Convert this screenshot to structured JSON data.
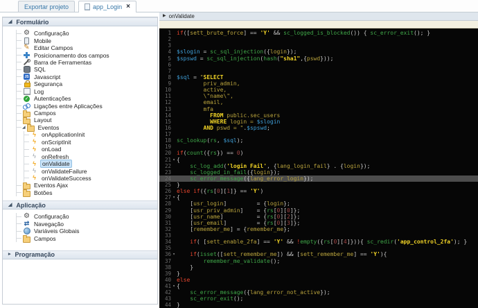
{
  "tabs": [
    {
      "label": "Exportar projeto",
      "active": false
    },
    {
      "label": "app_Login",
      "active": true,
      "icon": "document",
      "close": "×"
    }
  ],
  "sidebar": {
    "sections": [
      {
        "title": "Formulário",
        "state": "expanded",
        "items": [
          {
            "label": "Configuração",
            "icon": "gear"
          },
          {
            "label": "Mobile",
            "icon": "phone"
          },
          {
            "label": "Editar Campos",
            "icon": "edit"
          },
          {
            "label": "Posicionamento dos campos",
            "icon": "move"
          },
          {
            "label": "Barra de Ferramentas",
            "icon": "tools"
          },
          {
            "label": "SQL",
            "icon": "db"
          },
          {
            "label": "Javascript",
            "icon": "js"
          },
          {
            "label": "Segurança",
            "icon": "lock"
          },
          {
            "label": "Log",
            "icon": "log"
          },
          {
            "label": "Autenticações",
            "icon": "auth"
          },
          {
            "label": "Ligações entre Aplicações",
            "icon": "link"
          },
          {
            "label": "Campos",
            "icon": "folder"
          },
          {
            "label": "Layout",
            "icon": "folder"
          },
          {
            "label": "Eventos",
            "icon": "folder",
            "expanded": true,
            "children": [
              {
                "label": "onApplicationInit",
                "icon": "bolt"
              },
              {
                "label": "onScriptInit",
                "icon": "bolt"
              },
              {
                "label": "onLoad",
                "icon": "bolt"
              },
              {
                "label": "onRefresh",
                "icon": "boltg"
              },
              {
                "label": "onValidate",
                "icon": "bolt",
                "selected": true
              },
              {
                "label": "onValidateFailure",
                "icon": "boltg"
              },
              {
                "label": "onValidateSuccess",
                "icon": "bolt"
              }
            ]
          },
          {
            "label": "Eventos Ajax",
            "icon": "folder"
          },
          {
            "label": "Botões",
            "icon": "folder"
          }
        ]
      },
      {
        "title": "Aplicação",
        "state": "expanded",
        "items": [
          {
            "label": "Configuração",
            "icon": "gear"
          },
          {
            "label": "Navegação",
            "icon": "nav"
          },
          {
            "label": "Variáveis Globais",
            "icon": "globe"
          },
          {
            "label": "Campos",
            "icon": "folder"
          }
        ]
      },
      {
        "title": "Programação",
        "state": "collapsed",
        "items": []
      }
    ]
  },
  "editor": {
    "header": {
      "title": "onValidate"
    },
    "palette": {
      "background": "#060606",
      "keyword": "#e8462e",
      "function": "#3fa648",
      "variable": "#3f9fd8",
      "field": "#b9a33c",
      "string": "#f2d426",
      "number": "#a04545",
      "plain": "#c9c9c9",
      "active_line": "#4c4c4c",
      "selected_item": "#c9e3f8"
    },
    "lines": [
      {
        "n": 1,
        "tk": [
          [
            "k",
            "if"
          ],
          [
            "p",
            "(["
          ],
          [
            "g",
            "sett_brute_force"
          ],
          [
            "p",
            "] == "
          ],
          [
            "s",
            "'Y'"
          ],
          [
            "p",
            " && "
          ],
          [
            "f",
            "sc_logged_is_blocked"
          ],
          [
            "p",
            "()) { "
          ],
          [
            "f",
            "sc_error_exit"
          ],
          [
            "p",
            "(); }"
          ]
        ]
      },
      {
        "n": 2,
        "tk": []
      },
      {
        "n": 3,
        "tk": []
      },
      {
        "n": 4,
        "tk": [
          [
            "v",
            "$slogin"
          ],
          [
            "p",
            " = "
          ],
          [
            "f",
            "sc_sql_injection"
          ],
          [
            "p",
            "({"
          ],
          [
            "g",
            "login"
          ],
          [
            "p",
            "});"
          ]
        ]
      },
      {
        "n": 5,
        "tk": [
          [
            "v",
            "$spswd"
          ],
          [
            "p",
            " = "
          ],
          [
            "f",
            "sc_sql_injection"
          ],
          [
            "p",
            "("
          ],
          [
            "f",
            "hash"
          ],
          [
            "p",
            "("
          ],
          [
            "s",
            "\"sha1\""
          ],
          [
            "p",
            ",{"
          ],
          [
            "g",
            "pswd"
          ],
          [
            "p",
            "}));"
          ]
        ]
      },
      {
        "n": 6,
        "tk": []
      },
      {
        "n": 7,
        "tk": []
      },
      {
        "n": 8,
        "tk": [
          [
            "v",
            "$sql"
          ],
          [
            "p",
            " = "
          ],
          [
            "t",
            "\""
          ],
          [
            "q",
            "SELECT"
          ]
        ]
      },
      {
        "n": 9,
        "tk": [
          [
            "t",
            "        priv_admin,"
          ]
        ]
      },
      {
        "n": 10,
        "tk": [
          [
            "t",
            "        active,"
          ]
        ]
      },
      {
        "n": 11,
        "tk": [
          [
            "t",
            "        \\\"name\\\","
          ]
        ]
      },
      {
        "n": 12,
        "tk": [
          [
            "t",
            "        email,"
          ]
        ]
      },
      {
        "n": 13,
        "tk": [
          [
            "t",
            "        mfa"
          ]
        ]
      },
      {
        "n": 14,
        "tk": [
          [
            "t",
            "          "
          ],
          [
            "q",
            "FROM"
          ],
          [
            "t",
            " public.sec_users"
          ]
        ]
      },
      {
        "n": 15,
        "tk": [
          [
            "t",
            "          "
          ],
          [
            "q",
            "WHERE"
          ],
          [
            "t",
            " login = "
          ],
          [
            "v",
            "$slogin"
          ]
        ]
      },
      {
        "n": 16,
        "tk": [
          [
            "t",
            "        "
          ],
          [
            "q",
            "AND"
          ],
          [
            "t",
            " pswd = \""
          ],
          [
            "p",
            "."
          ],
          [
            "v",
            "$spswd"
          ],
          [
            "p",
            ";"
          ]
        ]
      },
      {
        "n": 17,
        "tk": []
      },
      {
        "n": 18,
        "tk": [
          [
            "f",
            "sc_lookup"
          ],
          [
            "p",
            "("
          ],
          [
            "f",
            "rs"
          ],
          [
            "p",
            ", "
          ],
          [
            "v",
            "$sql"
          ],
          [
            "p",
            ");"
          ]
        ]
      },
      {
        "n": 19,
        "tk": []
      },
      {
        "n": 20,
        "tk": [
          [
            "k",
            "if"
          ],
          [
            "p",
            "("
          ],
          [
            "f",
            "count"
          ],
          [
            "p",
            "({"
          ],
          [
            "f",
            "rs"
          ],
          [
            "p",
            "}) == "
          ],
          [
            "n",
            "0"
          ],
          [
            "p",
            ")"
          ]
        ]
      },
      {
        "n": 21,
        "fold": true,
        "tk": [
          [
            "p",
            "{"
          ]
        ]
      },
      {
        "n": 22,
        "tk": [
          [
            "p",
            "    "
          ],
          [
            "f",
            "sc_log_add"
          ],
          [
            "p",
            "("
          ],
          [
            "s",
            "'login Fail'"
          ],
          [
            "p",
            ", {"
          ],
          [
            "g",
            "lang_login_fail"
          ],
          [
            "p",
            "} . {"
          ],
          [
            "g",
            "login"
          ],
          [
            "p",
            "});"
          ]
        ]
      },
      {
        "n": 23,
        "tk": [
          [
            "p",
            "    "
          ],
          [
            "f",
            "sc_logged_in_fail"
          ],
          [
            "p",
            "({"
          ],
          [
            "g",
            "login"
          ],
          [
            "p",
            "});"
          ]
        ]
      },
      {
        "n": 24,
        "active": true,
        "tk": [
          [
            "p",
            "    "
          ],
          [
            "f",
            "sc_error_message"
          ],
          [
            "p",
            "({"
          ],
          [
            "g",
            "lang_error_login"
          ],
          [
            "p",
            "});"
          ]
        ]
      },
      {
        "n": 25,
        "tk": [
          [
            "p",
            "}"
          ]
        ]
      },
      {
        "n": 26,
        "tk": [
          [
            "k",
            "else"
          ],
          [
            "p",
            " "
          ],
          [
            "k",
            "if"
          ],
          [
            "p",
            "({"
          ],
          [
            "f",
            "rs"
          ],
          [
            "p",
            "["
          ],
          [
            "n",
            "0"
          ],
          [
            "p",
            "]["
          ],
          [
            "n",
            "1"
          ],
          [
            "p",
            "]} == "
          ],
          [
            "s",
            "'Y'"
          ],
          [
            "p",
            ")"
          ]
        ]
      },
      {
        "n": 27,
        "fold": true,
        "tk": [
          [
            "p",
            "{"
          ]
        ]
      },
      {
        "n": 28,
        "tk": [
          [
            "p",
            "    ["
          ],
          [
            "g",
            "usr_login"
          ],
          [
            "p",
            "]         = {"
          ],
          [
            "g",
            "login"
          ],
          [
            "p",
            "};"
          ]
        ]
      },
      {
        "n": 29,
        "tk": [
          [
            "p",
            "    ["
          ],
          [
            "g",
            "usr_priv_admin"
          ],
          [
            "p",
            "]    = {"
          ],
          [
            "f",
            "rs"
          ],
          [
            "p",
            "["
          ],
          [
            "n",
            "0"
          ],
          [
            "p",
            "]["
          ],
          [
            "n",
            "0"
          ],
          [
            "p",
            "]};"
          ]
        ]
      },
      {
        "n": 30,
        "tk": [
          [
            "p",
            "    ["
          ],
          [
            "g",
            "usr_name"
          ],
          [
            "p",
            "]          = {"
          ],
          [
            "f",
            "rs"
          ],
          [
            "p",
            "["
          ],
          [
            "n",
            "0"
          ],
          [
            "p",
            "]["
          ],
          [
            "n",
            "2"
          ],
          [
            "p",
            "]};"
          ]
        ]
      },
      {
        "n": 31,
        "tk": [
          [
            "p",
            "    ["
          ],
          [
            "g",
            "usr_email"
          ],
          [
            "p",
            "]         = {"
          ],
          [
            "f",
            "rs"
          ],
          [
            "p",
            "["
          ],
          [
            "n",
            "0"
          ],
          [
            "p",
            "]["
          ],
          [
            "n",
            "3"
          ],
          [
            "p",
            "]};"
          ]
        ]
      },
      {
        "n": 32,
        "tk": [
          [
            "p",
            "    ["
          ],
          [
            "g",
            "remember_me"
          ],
          [
            "p",
            "] = {"
          ],
          [
            "g",
            "remember_me"
          ],
          [
            "p",
            "};"
          ]
        ]
      },
      {
        "n": 33,
        "tk": []
      },
      {
        "n": 34,
        "tk": [
          [
            "p",
            "    "
          ],
          [
            "k",
            "if"
          ],
          [
            "p",
            "( ["
          ],
          [
            "g",
            "sett_enable_2fa"
          ],
          [
            "p",
            "] == "
          ],
          [
            "s",
            "'Y'"
          ],
          [
            "p",
            " && "
          ],
          [
            "k",
            "!"
          ],
          [
            "f",
            "empty"
          ],
          [
            "p",
            "({"
          ],
          [
            "f",
            "rs"
          ],
          [
            "p",
            "["
          ],
          [
            "n",
            "0"
          ],
          [
            "p",
            "]["
          ],
          [
            "n",
            "4"
          ],
          [
            "p",
            "]})){ "
          ],
          [
            "f",
            "sc_redir"
          ],
          [
            "p",
            "("
          ],
          [
            "s",
            "'app_control_2fa'"
          ],
          [
            "p",
            "); }"
          ]
        ]
      },
      {
        "n": 35,
        "tk": []
      },
      {
        "n": 36,
        "fold": true,
        "tk": [
          [
            "p",
            "    "
          ],
          [
            "k",
            "if"
          ],
          [
            "p",
            "("
          ],
          [
            "f",
            "isset"
          ],
          [
            "p",
            "(["
          ],
          [
            "g",
            "sett_remember_me"
          ],
          [
            "p",
            "]) && ["
          ],
          [
            "g",
            "sett_remember_me"
          ],
          [
            "p",
            "] == "
          ],
          [
            "s",
            "'Y'"
          ],
          [
            "p",
            "){"
          ]
        ]
      },
      {
        "n": 37,
        "tk": [
          [
            "p",
            "        "
          ],
          [
            "f",
            "remember_me_validate"
          ],
          [
            "p",
            "();"
          ]
        ]
      },
      {
        "n": 38,
        "tk": [
          [
            "p",
            "    }"
          ]
        ]
      },
      {
        "n": 39,
        "tk": [
          [
            "p",
            "}"
          ]
        ]
      },
      {
        "n": 40,
        "tk": [
          [
            "k",
            "else"
          ]
        ]
      },
      {
        "n": 41,
        "fold": true,
        "tk": [
          [
            "p",
            "{"
          ]
        ]
      },
      {
        "n": 42,
        "tk": [
          [
            "p",
            "    "
          ],
          [
            "f",
            "sc_error_message"
          ],
          [
            "p",
            "({"
          ],
          [
            "g",
            "lang_error_not_active"
          ],
          [
            "p",
            "});"
          ]
        ]
      },
      {
        "n": 43,
        "tk": [
          [
            "p",
            "    "
          ],
          [
            "f",
            "sc_error_exit"
          ],
          [
            "p",
            "();"
          ]
        ]
      },
      {
        "n": 44,
        "tk": [
          [
            "p",
            "}"
          ]
        ]
      }
    ]
  }
}
